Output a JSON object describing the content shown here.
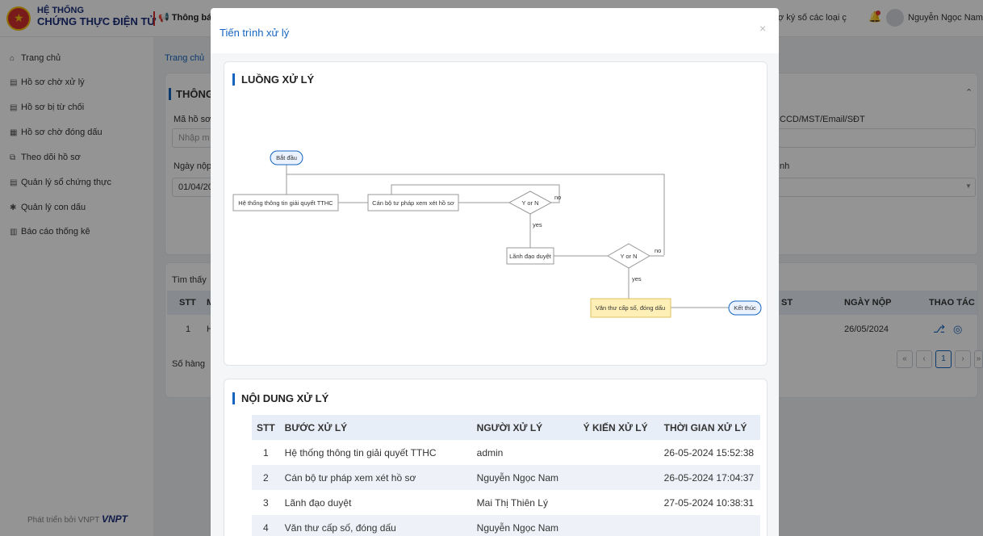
{
  "app": {
    "brand_line1": "HỆ THỐNG",
    "brand_line2": "CHỨNG THỰC ĐIỆN TỬ",
    "notice": "Thông báo",
    "top_right_text": "ợ ký số các loại ç",
    "user_name": "Nguyễn Ngọc Nam"
  },
  "sidebar": {
    "items": [
      {
        "icon": "home-icon",
        "label": "Trang chủ"
      },
      {
        "icon": "document-icon",
        "label": "Hồ sơ chờ xử lý"
      },
      {
        "icon": "document-icon",
        "label": "Hồ sơ bị từ chối"
      },
      {
        "icon": "grid-icon",
        "label": "Hồ sơ chờ đóng dấu"
      },
      {
        "icon": "windows-icon",
        "label": "Theo dõi hồ sơ"
      },
      {
        "icon": "document-icon",
        "label": "Quản lý sổ chứng thực"
      },
      {
        "icon": "gear-icon",
        "label": "Quản lý con dấu"
      },
      {
        "icon": "chart-icon",
        "label": "Báo cáo thống kê"
      }
    ],
    "footer_text": "Phát triển bởi VNPT",
    "footer_brand": "VNPT"
  },
  "background": {
    "breadcrumb": "Trang chủ",
    "section_title": "THÔNG",
    "field1_label": "Mã hồ sơ",
    "field1_placeholder": "Nhập m",
    "field2_label": "Ngày nộp",
    "field2_value": "01/04/20",
    "right_field1_label": "CCD/MST/Email/SĐT",
    "right_field2_label": "nh",
    "found_text": "Tìm thấy",
    "col_stt": "STT",
    "col_m": "M",
    "col_st": "ST",
    "col_date": "NGÀY NỘP",
    "col_action": "THAO TÁC",
    "row_no": "1",
    "row_h": "H",
    "row_date": "26/05/2024",
    "rows_label": "Số hàng",
    "pager": [
      "«",
      "‹",
      "1",
      "›",
      "»"
    ]
  },
  "modal": {
    "title": "Tiến trình xử lý",
    "close": "×",
    "flow_title": "LUỒNG XỬ LÝ",
    "flow": {
      "start": "Bắt đầu",
      "step1": "Hệ thống thông tin giải quyết TTHC",
      "step2": "Cán bộ tư pháp xem xét hồ sơ",
      "decision1": "Y or N",
      "no1": "no",
      "yes1": "yes",
      "step3": "Lãnh đạo duyệt",
      "decision2": "Y or N",
      "no2": "no",
      "yes2": "yes",
      "step4": "Văn thư cấp số, đóng dấu",
      "end": "Kết thúc"
    },
    "content_title": "NỘI DUNG XỬ LÝ",
    "columns": [
      "STT",
      "BƯỚC XỬ LÝ",
      "NGƯỜI XỬ LÝ",
      "Ý KIẾN XỬ LÝ",
      "THỜI GIAN XỬ LÝ"
    ],
    "rows": [
      {
        "stt": "1",
        "step": "Hệ thống thông tin giải quyết TTHC",
        "person": "admin",
        "opinion": "",
        "time": "26-05-2024 15:52:38"
      },
      {
        "stt": "2",
        "step": "Cán bộ tư pháp xem xét hồ sơ",
        "person": "Nguyễn Ngọc Nam",
        "opinion": "",
        "time": "26-05-2024 17:04:37"
      },
      {
        "stt": "3",
        "step": "Lãnh đạo duyệt",
        "person": "Mai Thị Thiên Lý",
        "opinion": "",
        "time": "27-05-2024 10:38:31"
      },
      {
        "stt": "4",
        "step": "Văn thư cấp số, đóng dấu",
        "person": "Nguyễn Ngọc Nam",
        "opinion": "",
        "time": ""
      }
    ]
  },
  "colors": {
    "accent": "#1565c0",
    "highlight_step": "#fdefb5",
    "table_header": "#e8eef7"
  }
}
